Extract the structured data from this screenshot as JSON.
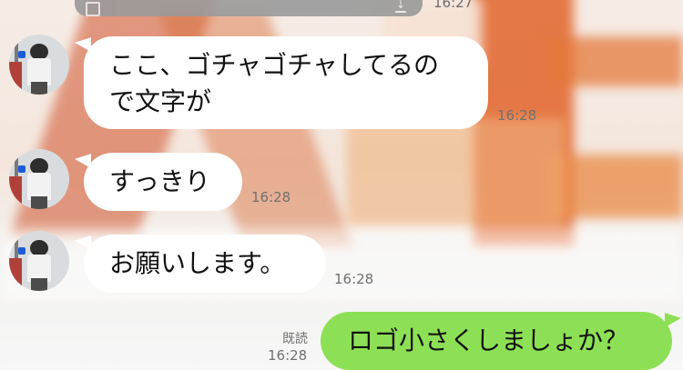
{
  "chat": {
    "messages": [
      {
        "side": "incoming",
        "text": "ここ、ゴチャゴチャしてるので文字が",
        "line1": "ここ、ゴチャゴチャしてるの",
        "line2": "で文字が",
        "time": "16:28"
      },
      {
        "side": "incoming",
        "text": "すっきり",
        "time": "16:28"
      },
      {
        "side": "incoming",
        "text": "お願いします。",
        "time": "16:28"
      },
      {
        "side": "outgoing",
        "text": "ロゴ小さくしましょか？",
        "time": "16:28",
        "status": "既読"
      }
    ],
    "top_partial_time": "16:27"
  },
  "colors": {
    "incoming_bubble": "#ffffff",
    "outgoing_bubble": "#8de055",
    "timestamp": "#707070"
  }
}
